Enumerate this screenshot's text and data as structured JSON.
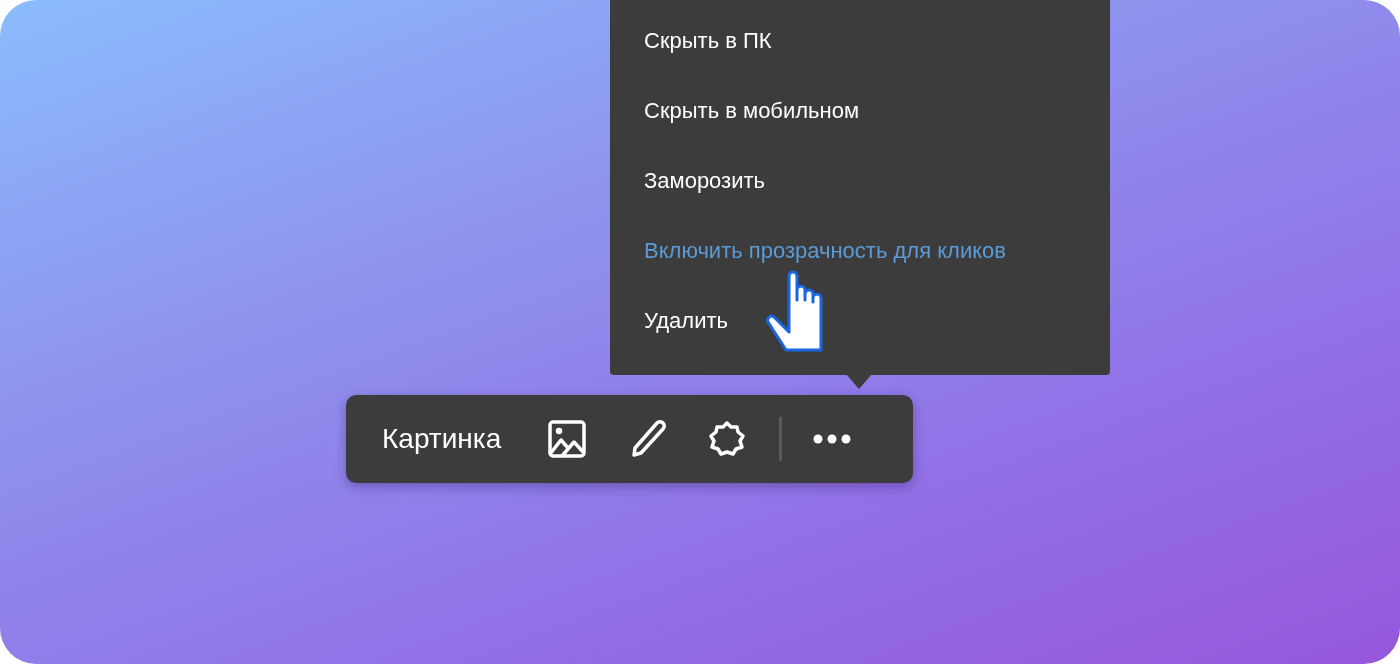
{
  "menu": {
    "items": [
      {
        "label": "Скрыть в ПК",
        "selected": false
      },
      {
        "label": "Скрыть в мобильном",
        "selected": false
      },
      {
        "label": "Заморозить",
        "selected": false
      },
      {
        "label": "Включить прозрачность для кликов",
        "selected": true
      },
      {
        "label": "Удалить",
        "selected": false
      }
    ]
  },
  "toolbar": {
    "title": "Картинка"
  }
}
